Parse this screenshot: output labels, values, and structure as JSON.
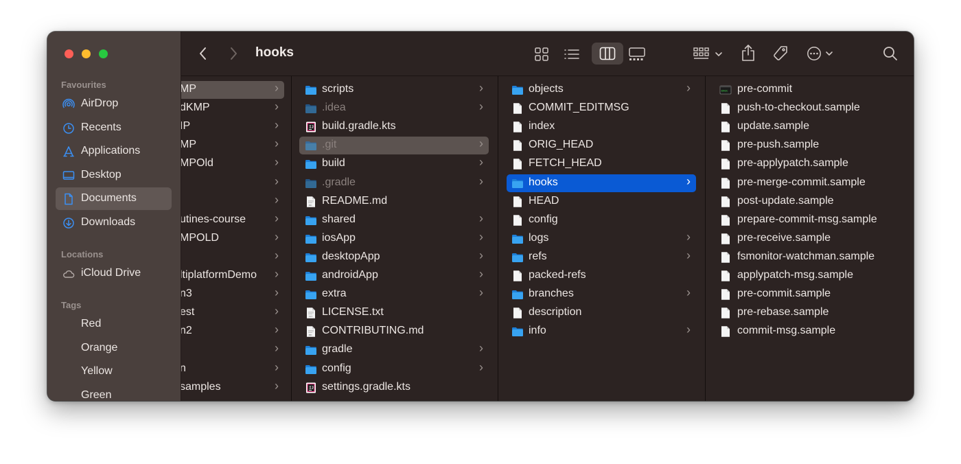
{
  "window": {
    "title": "hooks"
  },
  "sidebar": {
    "favourites_label": "Favourites",
    "favourites": [
      {
        "label": "AirDrop",
        "icon": "airdrop-icon"
      },
      {
        "label": "Recents",
        "icon": "clock-icon"
      },
      {
        "label": "Applications",
        "icon": "applications-icon"
      },
      {
        "label": "Desktop",
        "icon": "desktop-icon"
      },
      {
        "label": "Documents",
        "icon": "document-icon",
        "selected": true
      },
      {
        "label": "Downloads",
        "icon": "download-icon"
      }
    ],
    "locations_label": "Locations",
    "locations": [
      {
        "label": "iCloud Drive",
        "icon": "cloud-icon"
      }
    ],
    "tags_label": "Tags",
    "tags": [
      {
        "label": "Red",
        "color": "#fe4f4a"
      },
      {
        "label": "Orange",
        "color": "#f9a51f"
      },
      {
        "label": "Yellow",
        "color": "#f6e419"
      },
      {
        "label": "Green",
        "color": "#2ad142"
      }
    ]
  },
  "toolbar": {
    "back_icon": "chevron-left-icon",
    "forward_icon": "chevron-right-icon",
    "view_icons": [
      "icon-view-icon",
      "list-view-icon",
      "column-view-icon",
      "gallery-view-icon"
    ],
    "selected_view": "column-view-icon",
    "group_icon": "group-icon",
    "share_icon": "share-icon",
    "tag_icon": "tag-icon",
    "more_icon": "more-icon",
    "search_icon": "search-icon"
  },
  "columns": {
    "col1": [
      {
        "name": "MP",
        "folder": true,
        "selected": "gray"
      },
      {
        "name": "dKMP",
        "folder": true
      },
      {
        "name": "IP",
        "folder": true
      },
      {
        "name": "MP",
        "folder": true
      },
      {
        "name": "MPOld",
        "folder": true
      },
      {
        "name": "",
        "folder": true
      },
      {
        "name": "",
        "folder": true
      },
      {
        "name": "utines-course",
        "folder": true
      },
      {
        "name": "MPOLD",
        "folder": true
      },
      {
        "name": "",
        "folder": true
      },
      {
        "name": "ltiplatformDemo",
        "folder": true
      },
      {
        "name": "n3",
        "folder": true
      },
      {
        "name": "est",
        "folder": true
      },
      {
        "name": "n2",
        "folder": true
      },
      {
        "name": "",
        "folder": true
      },
      {
        "name": "n",
        "folder": true
      },
      {
        "name": "samples",
        "folder": true
      }
    ],
    "col2": [
      {
        "name": "scripts",
        "kind": "folder",
        "chevron": true
      },
      {
        "name": ".idea",
        "kind": "folder",
        "chevron": true,
        "dim": true
      },
      {
        "name": "build.gradle.kts",
        "kind": "kts"
      },
      {
        "name": ".git",
        "kind": "folder",
        "chevron": true,
        "dim": true,
        "selected": "gray"
      },
      {
        "name": "build",
        "kind": "folder",
        "chevron": true
      },
      {
        "name": ".gradle",
        "kind": "folder",
        "chevron": true,
        "dim": true
      },
      {
        "name": "README.md",
        "kind": "md"
      },
      {
        "name": "shared",
        "kind": "folder",
        "chevron": true
      },
      {
        "name": "iosApp",
        "kind": "folder",
        "chevron": true
      },
      {
        "name": "desktopApp",
        "kind": "folder",
        "chevron": true
      },
      {
        "name": "androidApp",
        "kind": "folder",
        "chevron": true
      },
      {
        "name": "extra",
        "kind": "folder",
        "chevron": true
      },
      {
        "name": "LICENSE.txt",
        "kind": "txt"
      },
      {
        "name": "CONTRIBUTING.md",
        "kind": "md"
      },
      {
        "name": "gradle",
        "kind": "folder",
        "chevron": true
      },
      {
        "name": "config",
        "kind": "folder",
        "chevron": true
      },
      {
        "name": "settings.gradle.kts",
        "kind": "kts"
      }
    ],
    "col3": [
      {
        "name": "objects",
        "kind": "folder",
        "chevron": true
      },
      {
        "name": "COMMIT_EDITMSG",
        "kind": "file"
      },
      {
        "name": "index",
        "kind": "file"
      },
      {
        "name": "ORIG_HEAD",
        "kind": "file"
      },
      {
        "name": "FETCH_HEAD",
        "kind": "file"
      },
      {
        "name": "hooks",
        "kind": "folder",
        "chevron": true,
        "selected": "blue"
      },
      {
        "name": "HEAD",
        "kind": "file"
      },
      {
        "name": "config",
        "kind": "file"
      },
      {
        "name": "logs",
        "kind": "folder",
        "chevron": true
      },
      {
        "name": "refs",
        "kind": "folder",
        "chevron": true
      },
      {
        "name": "packed-refs",
        "kind": "file"
      },
      {
        "name": "branches",
        "kind": "folder",
        "chevron": true
      },
      {
        "name": "description",
        "kind": "file"
      },
      {
        "name": "info",
        "kind": "folder",
        "chevron": true
      }
    ],
    "col4": [
      {
        "name": "pre-commit",
        "kind": "exec"
      },
      {
        "name": "push-to-checkout.sample",
        "kind": "file"
      },
      {
        "name": "update.sample",
        "kind": "file"
      },
      {
        "name": "pre-push.sample",
        "kind": "file"
      },
      {
        "name": "pre-applypatch.sample",
        "kind": "file"
      },
      {
        "name": "pre-merge-commit.sample",
        "kind": "file"
      },
      {
        "name": "post-update.sample",
        "kind": "file"
      },
      {
        "name": "prepare-commit-msg.sample",
        "kind": "file"
      },
      {
        "name": "pre-receive.sample",
        "kind": "file"
      },
      {
        "name": "fsmonitor-watchman.sample",
        "kind": "file"
      },
      {
        "name": "applypatch-msg.sample",
        "kind": "file"
      },
      {
        "name": "pre-commit.sample",
        "kind": "file"
      },
      {
        "name": "pre-rebase.sample",
        "kind": "file"
      },
      {
        "name": "commit-msg.sample",
        "kind": "file"
      }
    ]
  }
}
